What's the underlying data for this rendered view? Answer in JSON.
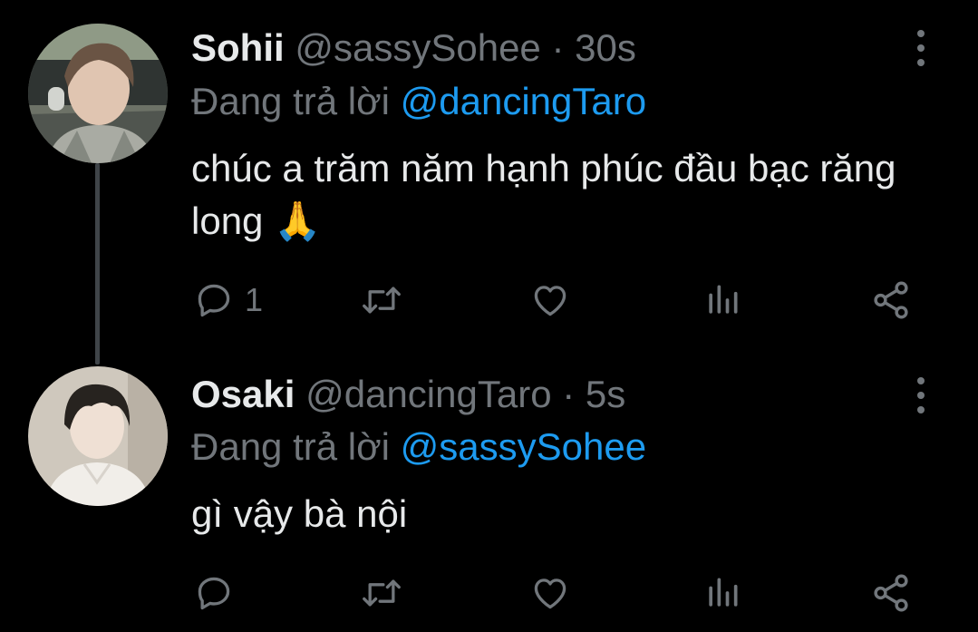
{
  "tweets": [
    {
      "display_name": "Sohii",
      "handle": "@sassySohee",
      "separator": "·",
      "time": "30s",
      "reply_prefix": "Đang trả lời",
      "reply_to": "@dancingTaro",
      "text": "chúc a trăm năm hạnh phúc đầu bạc răng long 🙏",
      "reply_count": "1",
      "avatar": "user-photo-avatar"
    },
    {
      "display_name": "Osaki",
      "handle": "@dancingTaro",
      "separator": "·",
      "time": "5s",
      "reply_prefix": "Đang trả lời",
      "reply_to": "@sassySohee",
      "text": "gì vậy bà nội",
      "reply_count": "",
      "avatar": "user-photo-avatar"
    }
  ],
  "icons": {
    "more": "more-vertical-icon",
    "reply": "reply-bubble-icon",
    "retweet": "retweet-icon",
    "like": "heart-icon",
    "views": "views-bar-chart-icon",
    "share": "share-icon"
  },
  "colors": {
    "background": "#000000",
    "text": "#e7e9ea",
    "muted": "#71767b",
    "accent": "#1d9bf0",
    "thread_line": "#3f4448"
  }
}
